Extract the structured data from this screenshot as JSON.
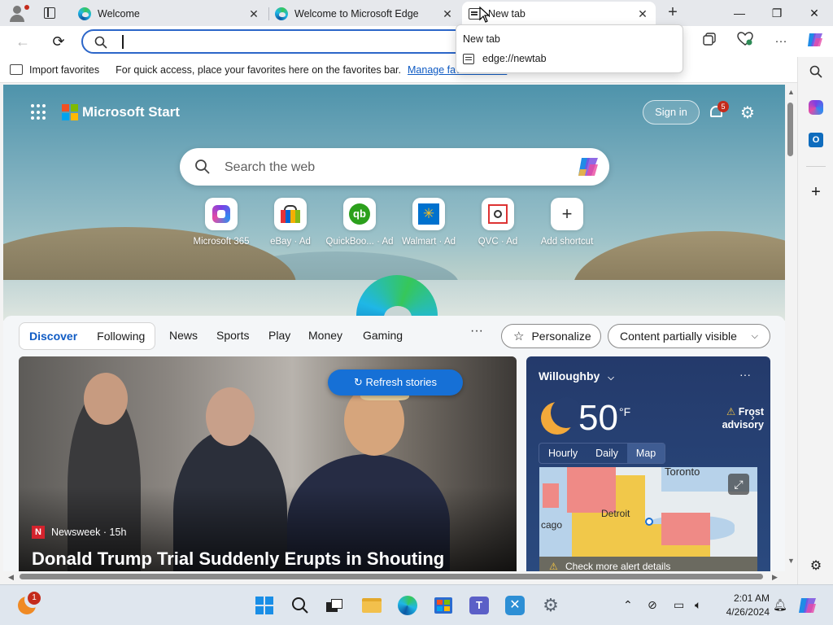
{
  "tabs": [
    {
      "title": "Welcome",
      "close": "✕",
      "icon": "edge-icon"
    },
    {
      "title": "Welcome to Microsoft Edge",
      "close": "✕",
      "icon": "edge-icon"
    },
    {
      "title": "New tab",
      "close": "✕",
      "icon": "new-tab-icon",
      "active": true
    }
  ],
  "window_controls": {
    "minimize": "—",
    "restore": "❐",
    "close": "✕",
    "new_tab": "+"
  },
  "toolbar": {
    "back": "←",
    "refresh": "⟳",
    "address_value": "",
    "more": "···"
  },
  "suggestion": {
    "header": "New tab",
    "item": "edge://newtab"
  },
  "favorites_bar": {
    "import_label": "Import favorites",
    "message": "For quick access, place your favorites here on the favorites bar.",
    "manage_link": "Manage favorites now"
  },
  "start": {
    "brand": "Microsoft Start",
    "sign_in": "Sign in",
    "notifications": "5",
    "search_placeholder": "Search the web",
    "quick_links": [
      {
        "label": "Microsoft 365",
        "icon": "m365-icon"
      },
      {
        "label": "eBay · Ad",
        "icon": "ebay-icon"
      },
      {
        "label": "QuickBoo... · Ad",
        "icon": "quickbooks-icon"
      },
      {
        "label": "Walmart · Ad",
        "icon": "walmart-icon"
      },
      {
        "label": "QVC · Ad",
        "icon": "qvc-icon"
      },
      {
        "label": "Add shortcut",
        "icon": "plus-icon"
      }
    ]
  },
  "feed": {
    "tabs": [
      "Discover",
      "Following"
    ],
    "nav": [
      "News",
      "Sports",
      "Play",
      "Money",
      "Gaming"
    ],
    "more": "···",
    "personalize": "Personalize",
    "content_visibility": "Content partially visible",
    "refresh": "Refresh stories",
    "story": {
      "source_logo": "N",
      "source": "Newsweek · 15h",
      "headline": "Donald Trump Trial Suddenly Erupts in Shouting"
    }
  },
  "weather": {
    "location": "Willoughby",
    "temp": "50",
    "unit": "°F",
    "alert": "Frost advisory",
    "tabs": [
      "Hourly",
      "Daily",
      "Map"
    ],
    "map_labels": {
      "toronto": "Toronto",
      "detroit": "Detroit",
      "chicago": "cago"
    },
    "alert_details": "Check more alert details"
  },
  "taskbar": {
    "time": "2:01 AM",
    "date": "4/26/2024",
    "widget_badge": "1"
  },
  "colors": {
    "accent": "#0f5bc4",
    "omnibox_border": "#2c66c9",
    "refresh_button": "#1670d6",
    "weather_bg": "#243a6b",
    "badge_red": "#c42b1c"
  }
}
